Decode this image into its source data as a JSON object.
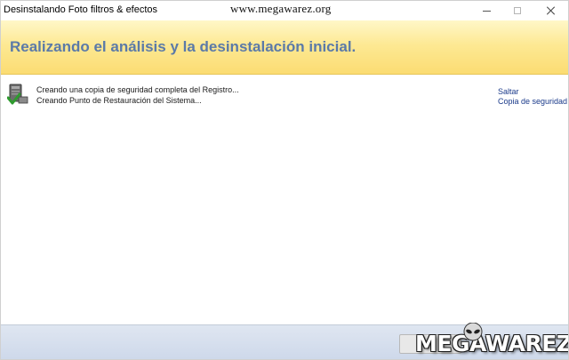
{
  "window": {
    "title": "Desinstalando Foto filtros & efectos",
    "watermark_url": "www.megawarez.org",
    "controls": {
      "minimize_icon": "minimize-icon",
      "maximize_icon": "maximize-icon",
      "close_icon": "close-icon"
    }
  },
  "header": {
    "title": "Realizando el análisis y la desinstalación inicial.",
    "title_color": "#5b7aa8",
    "band_color": "#fde994"
  },
  "steps": {
    "icon": "computer-check-icon",
    "items": [
      "Creando una copia de seguridad completa del Registro...",
      "Creando Punto de Restauración del Sistema..."
    ]
  },
  "links": {
    "skip": "Saltar",
    "backup": "Copia de seguridad",
    "color": "#1a3a8a"
  },
  "footer": {
    "logo_text": "MEGAWAREZ",
    "logo_icon": "alien-head-icon"
  }
}
